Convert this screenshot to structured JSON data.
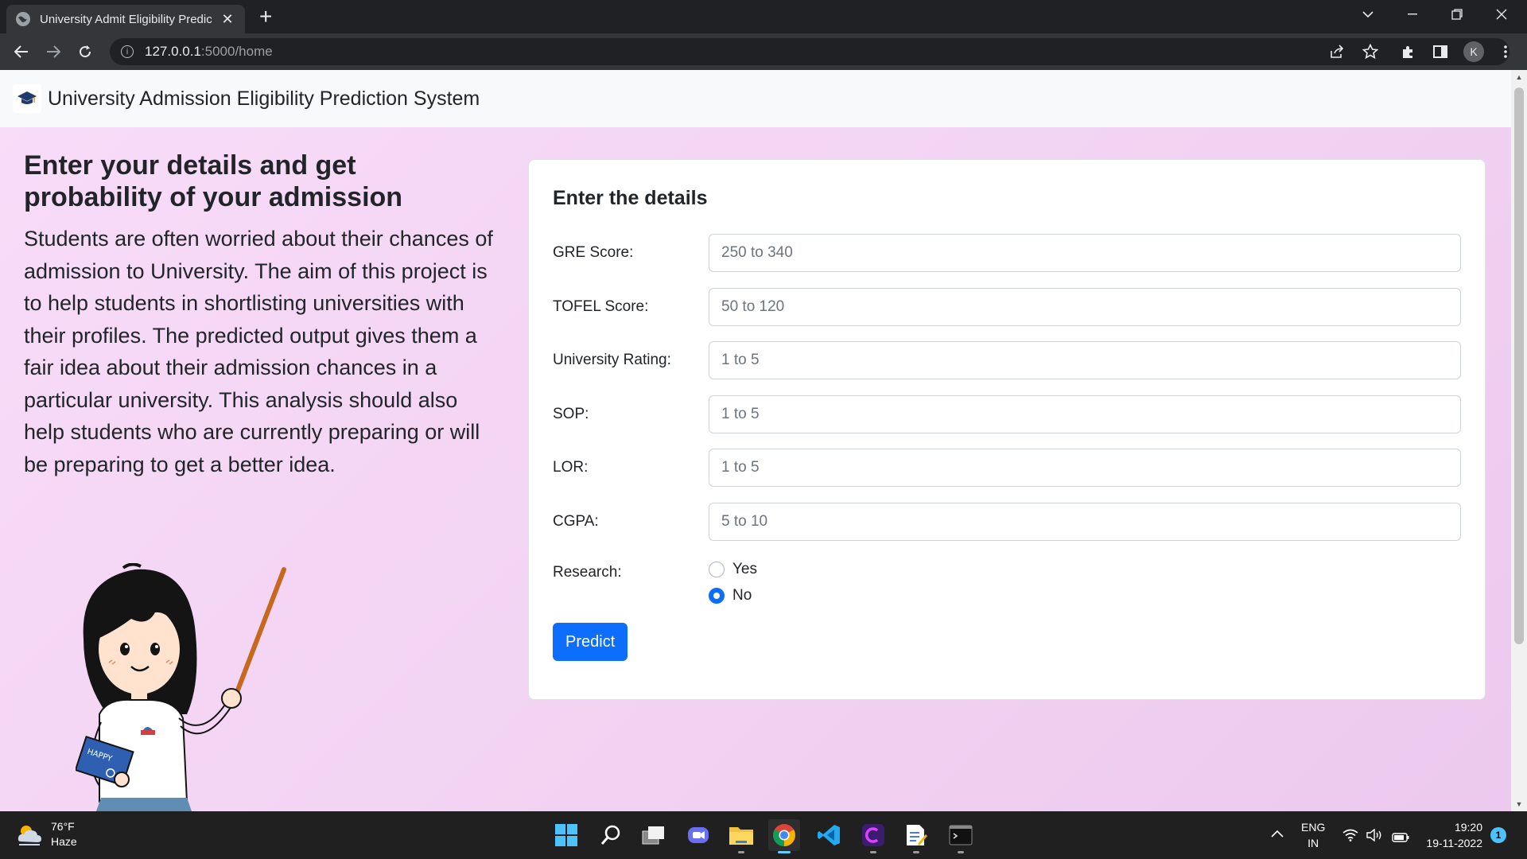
{
  "browser": {
    "tab_title": "University Admit Eligibility Predic",
    "url_host": "127.0.0.1",
    "url_path": ":5000/home"
  },
  "navbar": {
    "brand": "University Admission Eligibility Prediction System"
  },
  "intro": {
    "heading": "Enter your details and get probability of your admission",
    "paragraph": "Students are often worried about their chances of admission to University. The aim of this project is to help students in shortlisting universities with their profiles. The predicted output gives them a fair idea about their admission chances in a particular university. This analysis should also help students who are currently preparing or will be preparing to get a better idea."
  },
  "illustration": {
    "book_text": "HAPPY"
  },
  "form": {
    "title": "Enter the details",
    "fields": [
      {
        "label": "GRE Score:",
        "placeholder": "250 to 340",
        "value": ""
      },
      {
        "label": "TOFEL Score:",
        "placeholder": "50 to 120",
        "value": ""
      },
      {
        "label": "University Rating:",
        "placeholder": "1 to 5",
        "value": ""
      },
      {
        "label": "SOP:",
        "placeholder": "1 to 5",
        "value": ""
      },
      {
        "label": "LOR:",
        "placeholder": "1 to 5",
        "value": ""
      },
      {
        "label": "CGPA:",
        "placeholder": "5 to 10",
        "value": ""
      }
    ],
    "research": {
      "label": "Research:",
      "options": [
        "Yes",
        "No"
      ],
      "selected": "No"
    },
    "submit_label": "Predict"
  },
  "colors": {
    "primary": "#0d6efd",
    "page_bg": "#f4d7f4",
    "navbar_bg": "#f8f9fa"
  },
  "taskbar": {
    "weather_temp": "76°F",
    "weather_desc": "Haze",
    "lang_1": "ENG",
    "lang_2": "IN",
    "time": "19:20",
    "date": "19-11-2022",
    "notification_count": "1",
    "apps": [
      "start-icon",
      "search-icon",
      "task-view-icon",
      "chat-icon",
      "file-explorer-icon",
      "chrome-icon",
      "vscode-icon",
      "app-icon",
      "notepad-icon",
      "terminal-icon"
    ]
  }
}
